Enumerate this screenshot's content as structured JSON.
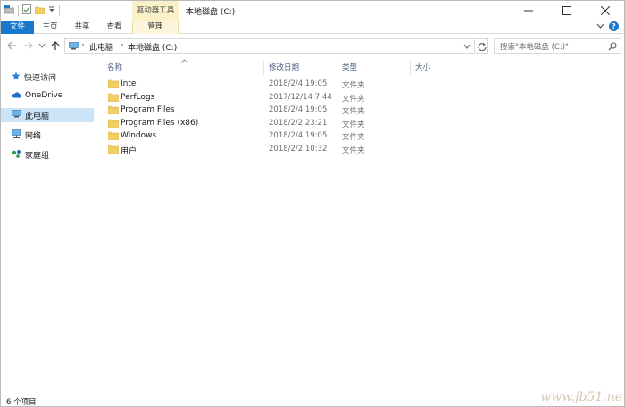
{
  "window": {
    "title": "本地磁盘 (C:)",
    "tool_tab_header": "驱动器工具"
  },
  "ribbon": {
    "tabs": [
      "文件",
      "主页",
      "共享",
      "查看"
    ],
    "manage_tab": "管理"
  },
  "address_bar": {
    "crumbs": [
      "此电脑",
      "本地磁盘 (C:)"
    ]
  },
  "search": {
    "placeholder": "搜索\"本地磁盘 (C:)\""
  },
  "nav_pane": {
    "items": [
      {
        "label": "快速访问",
        "icon": "star-icon"
      },
      {
        "label": "OneDrive",
        "icon": "cloud-icon"
      },
      {
        "label": "此电脑",
        "icon": "computer-icon",
        "selected": true
      },
      {
        "label": "网络",
        "icon": "network-icon"
      },
      {
        "label": "家庭组",
        "icon": "homegroup-icon"
      }
    ]
  },
  "columns": {
    "name": "名称",
    "date": "修改日期",
    "type": "类型",
    "size": "大小"
  },
  "files": [
    {
      "name": "Intel",
      "date": "2018/2/4 19:05",
      "type": "文件夹"
    },
    {
      "name": "PerfLogs",
      "date": "2017/12/14 7:44",
      "type": "文件夹"
    },
    {
      "name": "Program Files",
      "date": "2018/2/4 19:05",
      "type": "文件夹"
    },
    {
      "name": "Program Files (x86)",
      "date": "2018/2/2 23:21",
      "type": "文件夹"
    },
    {
      "name": "Windows",
      "date": "2018/2/4 19:05",
      "type": "文件夹"
    },
    {
      "name": "用户",
      "date": "2018/2/2 10:32",
      "type": "文件夹"
    }
  ],
  "status": {
    "item_count": "6 个项目"
  },
  "watermark": "www.jb51.ne",
  "colors": {
    "accent": "#1979ca",
    "tool_tab": "#fbf1c9",
    "folder": "#f3d066",
    "selection": "#cce4f7"
  }
}
